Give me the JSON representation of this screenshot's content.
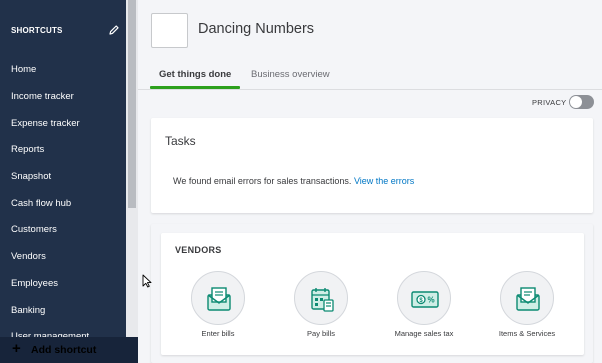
{
  "sidebar": {
    "header": "SHORTCUTS",
    "items": [
      {
        "label": "Home"
      },
      {
        "label": "Income tracker"
      },
      {
        "label": "Expense tracker"
      },
      {
        "label": "Reports"
      },
      {
        "label": "Snapshot"
      },
      {
        "label": "Cash flow hub"
      },
      {
        "label": "Customers"
      },
      {
        "label": "Vendors"
      },
      {
        "label": "Employees"
      },
      {
        "label": "Banking"
      },
      {
        "label": "User management"
      }
    ],
    "footer_label": "Add shortcut"
  },
  "header": {
    "company_name": "Dancing Numbers",
    "tabs": [
      {
        "label": "Get things done"
      },
      {
        "label": "Business overview"
      }
    ],
    "privacy_label": "PRIVACY"
  },
  "tasks": {
    "title": "Tasks",
    "message": "We found email errors for sales transactions.",
    "link": "View the errors"
  },
  "vendors": {
    "title": "VENDORS",
    "items": [
      {
        "label": "Enter bills",
        "icon": "bill-envelope-icon"
      },
      {
        "label": "Pay bills",
        "icon": "calendar-calculator-icon"
      },
      {
        "label": "Manage sales tax",
        "icon": "cash-percent-icon"
      },
      {
        "label": "Items & Services",
        "icon": "item-envelope-icon"
      }
    ]
  },
  "colors": {
    "sidebar_bg": "#21314a",
    "accent_green": "#2ca01c",
    "link_blue": "#0077c5",
    "icon_teal": "#0b8a72"
  }
}
